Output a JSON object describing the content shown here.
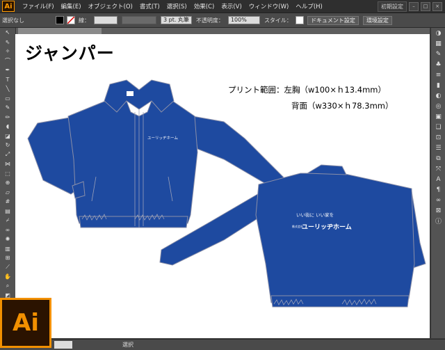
{
  "app": {
    "logo_text": "Ai",
    "menu": [
      "ファイル(F)",
      "編集(E)",
      "オブジェクト(O)",
      "書式(T)",
      "選択(S)",
      "効果(C)",
      "表示(V)",
      "ウィンドウ(W)",
      "ヘルプ(H)"
    ],
    "workspace_label": "初期設定"
  },
  "control_bar": {
    "selection_label": "選択なし",
    "stroke_label": "線：",
    "stroke_weight": "3 pt. 丸筆",
    "opacity_label": "不透明度：",
    "opacity_value": "100%",
    "style_label": "スタイル：",
    "doc_setup_button": "ドキュメント設定",
    "prefs_button": "環境設定",
    "accent_color": "#f0a020"
  },
  "artboard": {
    "title": "ジャンパー",
    "print_line1": "プリント範囲：左胸（w100×ｈ13.4mm）",
    "print_line2": "背面（w330×ｈ78.3mm）",
    "front_logo": "ユーリッヂホーム",
    "back_tagline": "いい街に いい家を",
    "back_logo": "ユーリッヂホーム",
    "back_logo_small": "株式会社",
    "jacket_color": "#1e4aa0"
  },
  "status": {
    "zoom": "",
    "mode": "選択"
  },
  "badge": {
    "text": "Ai",
    "color": "#f29000"
  }
}
